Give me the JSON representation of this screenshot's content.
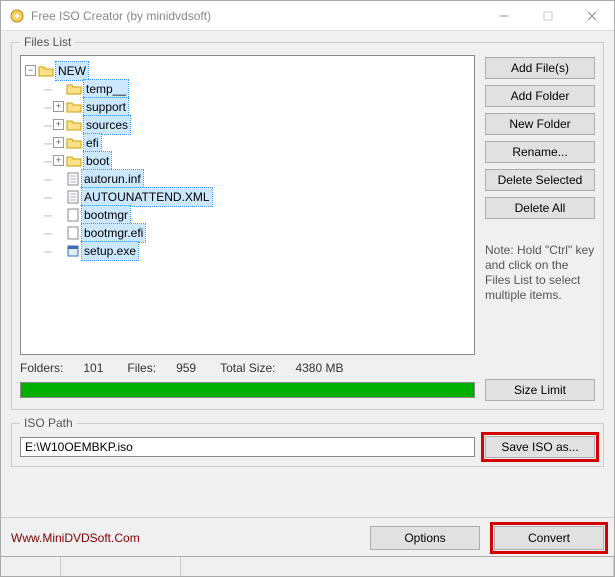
{
  "window": {
    "title": "Free ISO Creator (by minidvdsoft)"
  },
  "filesList": {
    "legend": "Files List",
    "rootName": "NEW",
    "children": [
      {
        "name": "temp__",
        "type": "folder",
        "expandable": false
      },
      {
        "name": "support",
        "type": "folder",
        "expandable": true
      },
      {
        "name": "sources",
        "type": "folder",
        "expandable": true
      },
      {
        "name": "efi",
        "type": "folder",
        "expandable": true
      },
      {
        "name": "boot",
        "type": "folder",
        "expandable": true
      },
      {
        "name": "autorun.inf",
        "type": "file-text"
      },
      {
        "name": "AUTOUNATTEND.XML",
        "type": "file-text"
      },
      {
        "name": "bootmgr",
        "type": "file"
      },
      {
        "name": "bootmgr.efi",
        "type": "file"
      },
      {
        "name": "setup.exe",
        "type": "file-exe"
      }
    ]
  },
  "buttons": {
    "addFiles": "Add File(s)",
    "addFolder": "Add Folder",
    "newFolder": "New Folder",
    "rename": "Rename...",
    "deleteSelected": "Delete Selected",
    "deleteAll": "Delete All",
    "sizeLimit": "Size Limit",
    "saveISO": "Save ISO as...",
    "options": "Options",
    "convert": "Convert"
  },
  "note": "Note: Hold \"Ctrl\" key and click on the Files List to select multiple items.",
  "stats": {
    "foldersLabel": "Folders:",
    "folders": "101",
    "filesLabel": "Files:",
    "files": "959",
    "totalSizeLabel": "Total Size:",
    "totalSize": "4380 MB"
  },
  "isoPath": {
    "legend": "ISO Path",
    "value": "E:\\W10OEMBKP.iso"
  },
  "link": "Www.MiniDVDSoft.Com"
}
